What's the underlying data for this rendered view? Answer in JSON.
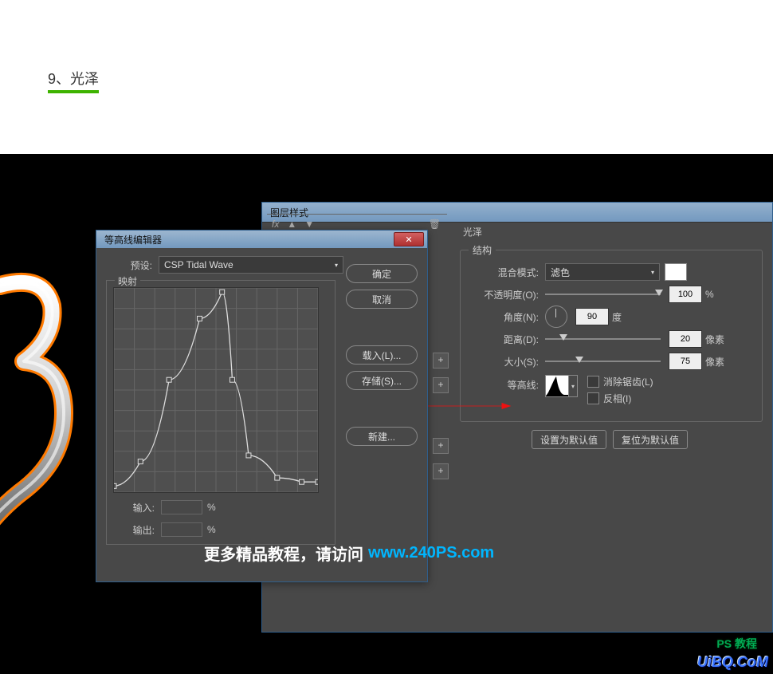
{
  "step_label": "9、光泽",
  "layer_style": {
    "title": "图层样式",
    "section_title": "光泽",
    "structure_legend": "结构",
    "blend_mode_label": "混合模式:",
    "blend_mode_value": "滤色",
    "color_swatch": "#ffffff",
    "opacity_label": "不透明度(O):",
    "opacity_value": "100",
    "opacity_unit": "%",
    "angle_label": "角度(N):",
    "angle_value": "90",
    "angle_unit": "度",
    "distance_label": "距离(D):",
    "distance_value": "20",
    "distance_unit": "像素",
    "size_label": "大小(S):",
    "size_value": "75",
    "size_unit": "像素",
    "contour_label": "等高线:",
    "antialias_label": "消除锯齿(L)",
    "invert_label": "反相(I)",
    "set_defaults": "设置为默认值",
    "reset_defaults": "复位为默认值",
    "footer_fx": "fx"
  },
  "contour_editor": {
    "title": "等高线编辑器",
    "preset_label": "预设:",
    "preset_value": "CSP Tidal Wave",
    "mapping_label": "映射",
    "input_label": "输入:",
    "output_label": "输出:",
    "pct": "%",
    "btn_ok": "确定",
    "btn_cancel": "取消",
    "btn_load": "载入(L)...",
    "btn_save": "存储(S)...",
    "btn_new": "新建..."
  },
  "watermark": {
    "text": "更多精品教程，请访问",
    "url": "www.240PS.com"
  },
  "logo_uibq": "UiBQ.CoM",
  "logo_ps": "PS 教程",
  "chart_data": {
    "type": "line",
    "title": "CSP Tidal Wave contour",
    "xlabel": "输入",
    "ylabel": "输出",
    "xlim": [
      0,
      100
    ],
    "ylim": [
      0,
      100
    ],
    "series": [
      {
        "name": "contour",
        "points": [
          {
            "x": 0,
            "y": 3
          },
          {
            "x": 13,
            "y": 15
          },
          {
            "x": 27,
            "y": 55
          },
          {
            "x": 42,
            "y": 85
          },
          {
            "x": 53,
            "y": 98
          },
          {
            "x": 58,
            "y": 55
          },
          {
            "x": 66,
            "y": 18
          },
          {
            "x": 80,
            "y": 7
          },
          {
            "x": 92,
            "y": 5
          },
          {
            "x": 100,
            "y": 5
          }
        ]
      }
    ]
  }
}
